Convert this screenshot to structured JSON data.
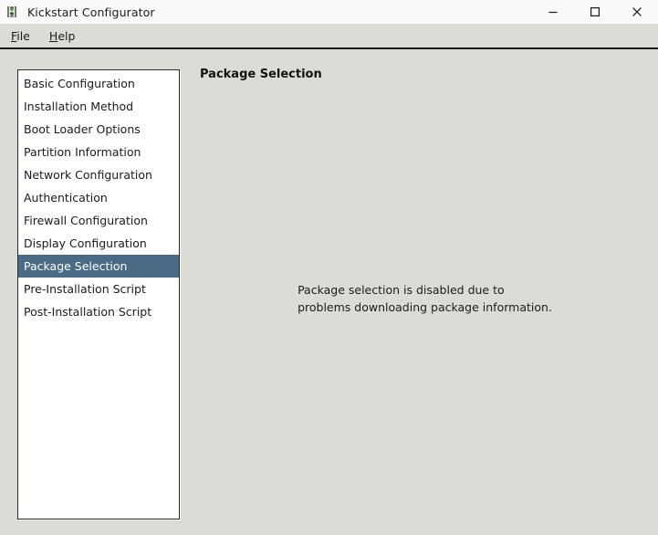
{
  "window": {
    "title": "Kickstart Configurator",
    "icon": "kickstart-app-icon",
    "controls": {
      "minimize": "minimize-icon",
      "maximize": "maximize-icon",
      "close": "close-icon"
    }
  },
  "menu": {
    "items": [
      {
        "label": "File",
        "mnemonic": "F",
        "rest": "ile"
      },
      {
        "label": "Help",
        "mnemonic": "H",
        "rest": "elp"
      }
    ]
  },
  "sidebar": {
    "selected_index": 8,
    "items": [
      {
        "label": "Basic Configuration"
      },
      {
        "label": "Installation Method"
      },
      {
        "label": "Boot Loader Options"
      },
      {
        "label": "Partition Information"
      },
      {
        "label": "Network Configuration"
      },
      {
        "label": "Authentication"
      },
      {
        "label": "Firewall Configuration"
      },
      {
        "label": "Display Configuration"
      },
      {
        "label": "Package Selection"
      },
      {
        "label": "Pre-Installation Script"
      },
      {
        "label": "Post-Installation Script"
      }
    ]
  },
  "main": {
    "title": "Package Selection",
    "message_line1": "Package selection is disabled due to",
    "message_line2": "problems downloading package information."
  },
  "colors": {
    "window_background": "#dcdcd6",
    "titlebar_background": "#fafafa",
    "list_background": "#ffffff",
    "selection_background": "#4a6b85",
    "selection_text": "#ffffff",
    "text": "#1b1b1b",
    "border": "#2b2b2b"
  }
}
